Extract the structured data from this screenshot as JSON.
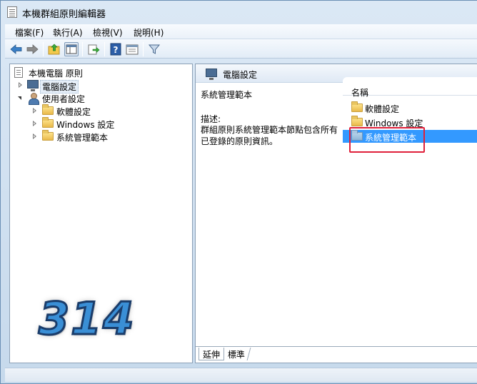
{
  "window": {
    "title": "本機群組原則編輯器"
  },
  "menu": [
    "檔案(F)",
    "執行(A)",
    "檢視(V)",
    "說明(H)"
  ],
  "toolbar": [
    "back-icon",
    "forward-icon",
    "up-folder-icon",
    "show-tree-icon",
    "export-icon",
    "help-icon",
    "properties-icon",
    "filter-icon"
  ],
  "tree": {
    "root": "本機電腦 原則",
    "computer": "電腦設定",
    "user": "使用者設定",
    "children": [
      "軟體設定",
      "Windows 設定",
      "系統管理範本"
    ]
  },
  "watermark": "314",
  "details": {
    "header": "電腦設定",
    "title": "系統管理範本",
    "desc_label": "描述:",
    "desc_text": "群組原則系統管理範本節點包含所有已登錄的原則資訊。"
  },
  "list": {
    "column": "名稱",
    "items": [
      "軟體設定",
      "Windows 設定",
      "系統管理範本"
    ],
    "selected_index": 2
  },
  "tabs": [
    "延伸",
    "標準"
  ],
  "colors": {
    "selection": "#3399ff",
    "highlight_box": "#e0203a"
  }
}
